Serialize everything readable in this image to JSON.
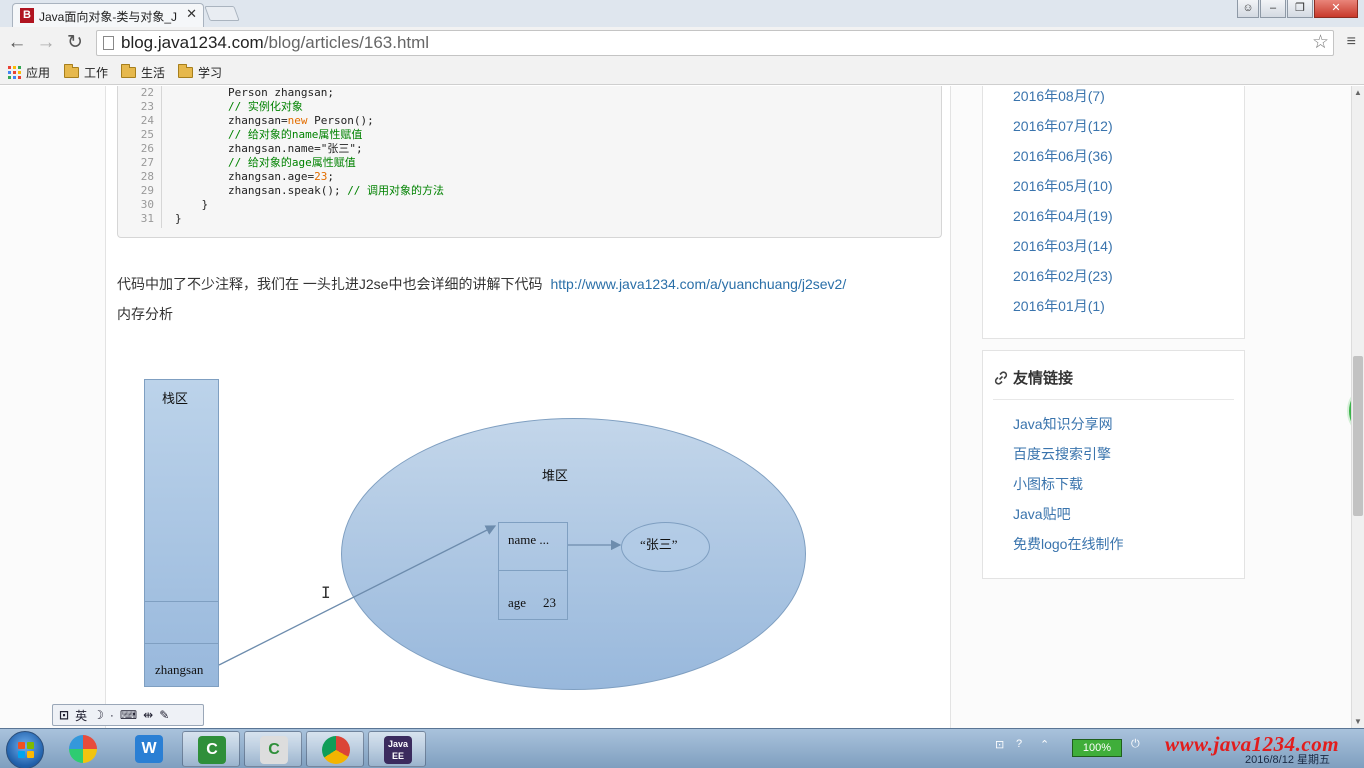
{
  "browser": {
    "tab_title": "Java面向对象-类与对象_J",
    "tab_favicon_letter": "B",
    "url_host": "blog.java1234.com",
    "url_path": "/blog/articles/163.html",
    "bookmarks": [
      "应用",
      "工作",
      "生活",
      "学习"
    ]
  },
  "code": {
    "lines": [
      {
        "n": "22",
        "parts": [
          {
            "t": "        Person zhangsan;",
            "c": "plain"
          }
        ]
      },
      {
        "n": "23",
        "parts": [
          {
            "t": "        // 实例化对象",
            "c": "cm"
          }
        ]
      },
      {
        "n": "24",
        "parts": [
          {
            "t": "        zhangsan=",
            "c": "plain"
          },
          {
            "t": "new",
            "c": "kw"
          },
          {
            "t": " Person();",
            "c": "plain"
          }
        ]
      },
      {
        "n": "25",
        "parts": [
          {
            "t": "        // 给对象的name属性赋值",
            "c": "cm"
          }
        ]
      },
      {
        "n": "26",
        "parts": [
          {
            "t": "        zhangsan.name=\"张三\";",
            "c": "plain"
          }
        ]
      },
      {
        "n": "27",
        "parts": [
          {
            "t": "        // 给对象的age属性赋值",
            "c": "cm"
          }
        ]
      },
      {
        "n": "28",
        "parts": [
          {
            "t": "        zhangsan.age=",
            "c": "plain"
          },
          {
            "t": "23",
            "c": "num"
          },
          {
            "t": ";",
            "c": "plain"
          }
        ]
      },
      {
        "n": "29",
        "parts": [
          {
            "t": "        zhangsan.speak(); ",
            "c": "plain"
          },
          {
            "t": "// 调用对象的方法",
            "c": "cm"
          }
        ]
      },
      {
        "n": "30",
        "parts": [
          {
            "t": "    }",
            "c": "plain"
          }
        ]
      },
      {
        "n": "31",
        "parts": [
          {
            "t": "}",
            "c": "plain"
          }
        ]
      }
    ]
  },
  "article": {
    "para1": "代码中加了不少注释，我们在 一头扎进J2se中也会详细的讲解下代码",
    "para1_link": "http://www.java1234.com/a/yuanchuang/j2sev2/",
    "para2": "内存分析"
  },
  "diagram": {
    "stack_label": "栈区",
    "stack_var": "zhangsan",
    "heap_label": "堆区",
    "field_name": "name ...",
    "field_age": "age",
    "age_value": "23",
    "string_value": "“张三”"
  },
  "sidebar": {
    "archives": [
      "2016年08月(7)",
      "2016年07月(12)",
      "2016年06月(36)",
      "2016年05月(10)",
      "2016年04月(19)",
      "2016年03月(14)",
      "2016年02月(23)",
      "2016年01月(1)"
    ],
    "links_title": "友情链接",
    "links": [
      "Java知识分享网",
      "百度云搜索引擎",
      "小图标下载",
      "Java贴吧",
      "免费logo在线制作"
    ]
  },
  "ime": {
    "lang": "英"
  },
  "taskbar": {
    "battery": "100%",
    "watermark": "www.java1234.com",
    "clock_date": "2016/8/12 星期五"
  }
}
